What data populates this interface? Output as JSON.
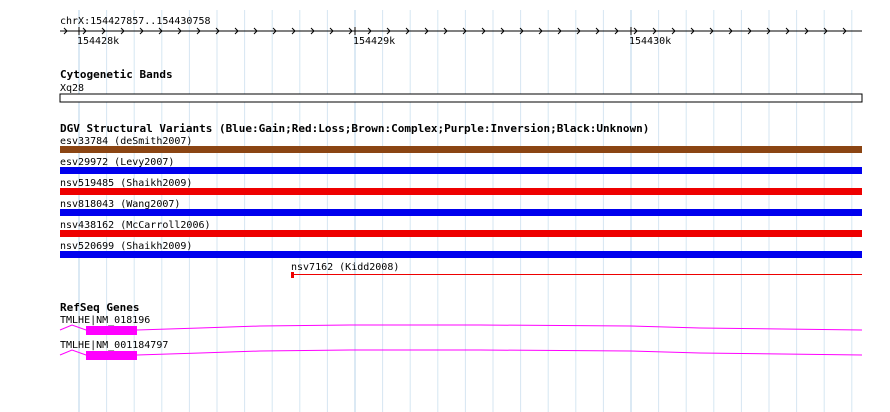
{
  "ruler": {
    "location": "chrX:154427857..154430758",
    "ticks": [
      "154428k",
      "154429k",
      "154430k"
    ]
  },
  "tracks": {
    "cytoband": {
      "title": "Cytogenetic Bands",
      "band": "Xq28"
    },
    "dgv": {
      "title": "DGV Structural Variants (Blue:Gain;Red:Loss;Brown:Complex;Purple:Inversion;Black:Unknown)",
      "variants": [
        {
          "label": "esv33784 (deSmith2007)",
          "type": "Complex",
          "color": "#8b4513"
        },
        {
          "label": "esv29972 (Levy2007)",
          "type": "Gain",
          "color": "#0000ee"
        },
        {
          "label": "nsv519485 (Shaikh2009)",
          "type": "Loss",
          "color": "#ee0000"
        },
        {
          "label": "nsv818043 (Wang2007)",
          "type": "Gain",
          "color": "#0000ee"
        },
        {
          "label": "nsv438162 (McCarroll2006)",
          "type": "Loss",
          "color": "#ee0000"
        },
        {
          "label": "nsv520699 (Shaikh2009)",
          "type": "Gain",
          "color": "#0000ee"
        },
        {
          "label": "nsv7162 (Kidd2008)",
          "type": "Loss",
          "color": "#ee0000"
        }
      ]
    },
    "refseq": {
      "title": "RefSeq Genes",
      "color": "#ff00ff",
      "genes": [
        {
          "label": "TMLHE|NM_018196"
        },
        {
          "label": "TMLHE|NM_001184797"
        }
      ]
    }
  }
}
